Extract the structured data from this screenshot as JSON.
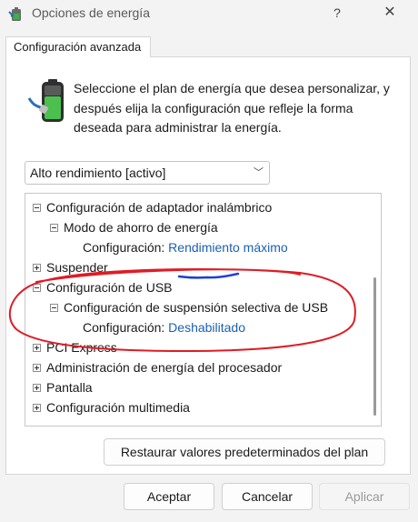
{
  "window": {
    "title": "Opciones de energía",
    "help": "?",
    "close": "✕"
  },
  "tab": {
    "label": "Configuración avanzada"
  },
  "intro": "Seleccione el plan de energía que desea personalizar, y después elija la configuración que refleje la forma deseada para administrar la energía.",
  "plan_select": {
    "value": "Alto rendimiento [activo]"
  },
  "tree": {
    "items": [
      {
        "text": "Configuración de adaptador inalámbrico",
        "expander": "minus"
      },
      {
        "text": "Modo de ahorro de energía",
        "expander": "minus"
      },
      {
        "label": "Configuración:",
        "value": "Rendimiento máximo"
      },
      {
        "text": "Suspender",
        "expander": "plus"
      },
      {
        "text": "Configuración de USB",
        "expander": "minus"
      },
      {
        "text": "Configuración de suspensión selectiva de USB",
        "expander": "minus"
      },
      {
        "label": "Configuración:",
        "value": "Deshabilitado"
      },
      {
        "text": "PCI Express",
        "expander": "plus"
      },
      {
        "text": "Administración de energía del procesador",
        "expander": "plus"
      },
      {
        "text": "Pantalla",
        "expander": "plus"
      },
      {
        "text": "Configuración multimedia",
        "expander": "plus"
      }
    ]
  },
  "buttons": {
    "restore": "Restaurar valores predeterminados del plan",
    "accept": "Aceptar",
    "cancel": "Cancelar",
    "apply": "Aplicar"
  },
  "colors": {
    "link": "#1a5fb4",
    "annotation": "#e01b24",
    "underline": "#1c3fd6"
  }
}
